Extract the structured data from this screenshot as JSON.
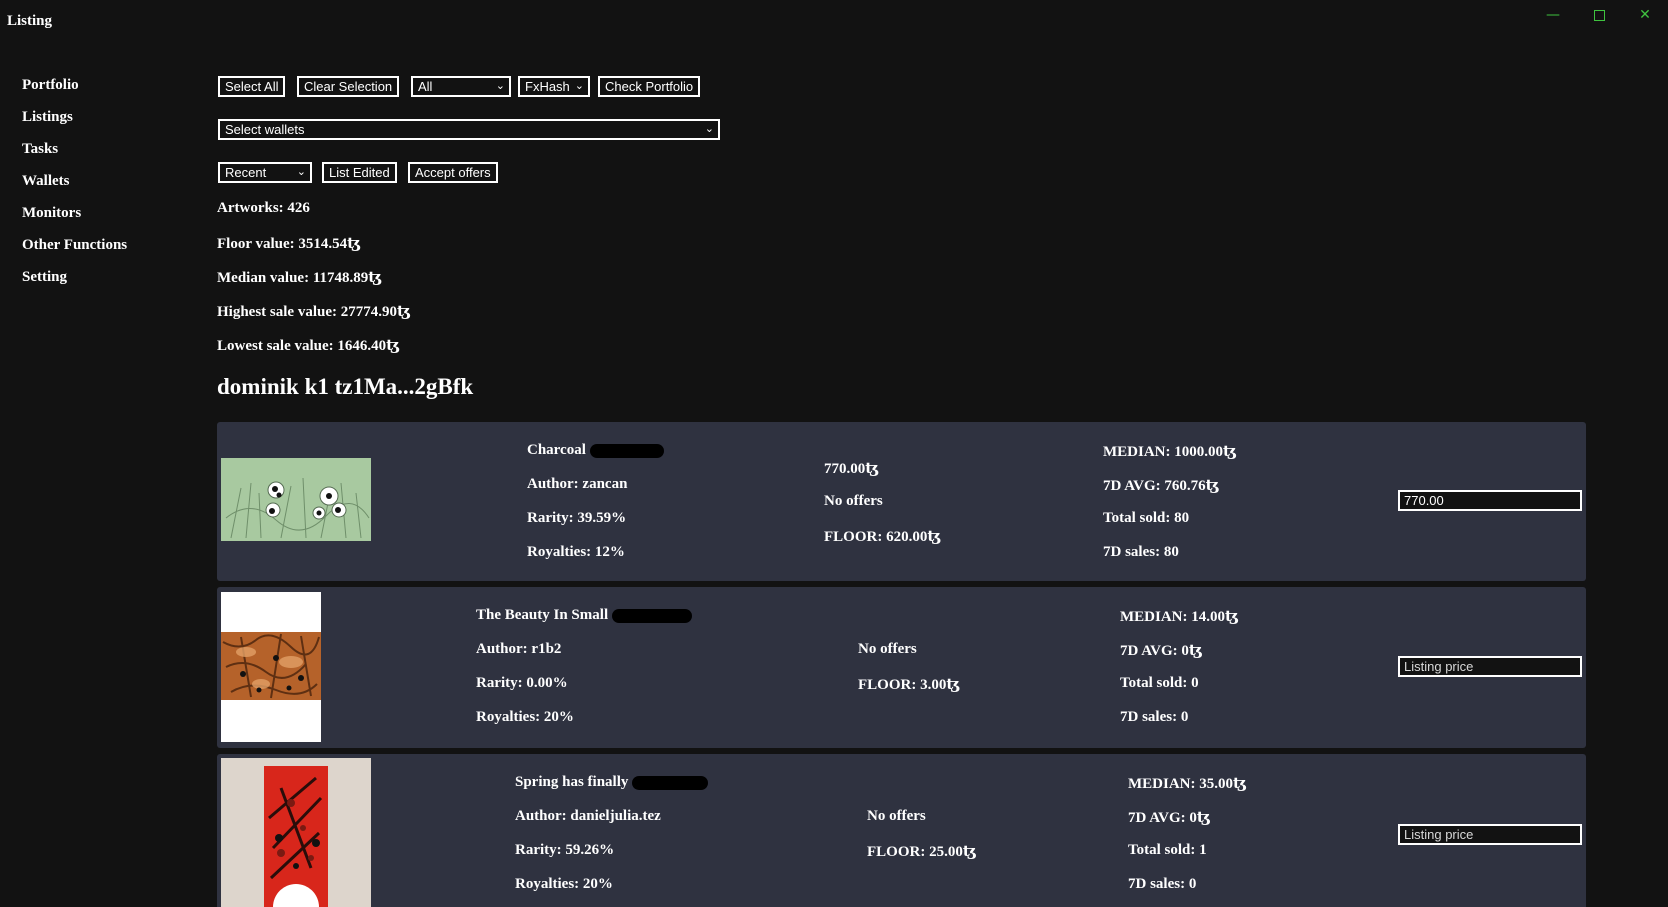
{
  "window": {
    "title": "Listing",
    "minimize_glyph": "—",
    "close_glyph": "✕"
  },
  "sidebar": {
    "items": [
      {
        "label": "Portfolio"
      },
      {
        "label": "Listings"
      },
      {
        "label": "Tasks"
      },
      {
        "label": "Wallets"
      },
      {
        "label": "Monitors"
      },
      {
        "label": "Other Functions"
      },
      {
        "label": "Setting"
      }
    ]
  },
  "toolbar": {
    "select_all": "Select All",
    "clear_selection": "Clear Selection",
    "filter_select": "All",
    "platform_select": "FxHash",
    "check_portfolio": "Check Portfolio",
    "wallet_select": "Select wallets",
    "sort_select": "Recent",
    "list_edited": "List Edited",
    "accept_offers": "Accept offers",
    "chevron_glyph": "⌄"
  },
  "stats": {
    "artworks": "Artworks: 426",
    "floor": "Floor value: 3514.54ꜩ",
    "median": "Median value: 11748.89ꜩ",
    "highest": "Highest sale value: 27774.90ꜩ",
    "lowest": "Lowest sale value: 1646.40ꜩ"
  },
  "wallet_heading": "dominik k1 tz1Ma...2gBfk",
  "listings": [
    {
      "title": "Charcoal",
      "author": "Author: zancan",
      "rarity": "Rarity: 39.59%",
      "royalties": "Royalties: 12%",
      "current_price": "770.00ꜩ",
      "offers": "No offers",
      "floor": "FLOOR: 620.00ꜩ",
      "median": "MEDIAN: 1000.00ꜩ",
      "avg7d": "7D AVG: 760.76ꜩ",
      "total_sold": "Total sold: 80",
      "sales7d": "7D sales: 80",
      "price_value": "770.00",
      "price_placeholder": "Listing price",
      "thumb_colors": {
        "bg": "#a8c9a0",
        "accent": "#6f8f6a"
      }
    },
    {
      "title": "The Beauty In Small",
      "author": "Author: r1b2",
      "rarity": "Rarity: 0.00%",
      "royalties": "Royalties: 20%",
      "current_price": "",
      "offers": "No offers",
      "floor": "FLOOR: 3.00ꜩ",
      "median": "MEDIAN: 14.00ꜩ",
      "avg7d": "7D AVG: 0ꜩ",
      "total_sold": "Total sold: 0",
      "sales7d": "7D sales: 0",
      "price_value": "",
      "price_placeholder": "Listing price",
      "thumb_colors": {
        "bg": "#ffffff",
        "accent": "#b5622a"
      }
    },
    {
      "title": "Spring has finally",
      "author": "Author: danieljulia.tez",
      "rarity": "Rarity: 59.26%",
      "royalties": "Royalties: 20%",
      "current_price": "",
      "offers": "No offers",
      "floor": "FLOOR: 25.00ꜩ",
      "median": "MEDIAN: 35.00ꜩ",
      "avg7d": "7D AVG: 0ꜩ",
      "total_sold": "Total sold: 1",
      "sales7d": "7D sales: 0",
      "price_value": "",
      "price_placeholder": "Listing price",
      "thumb_colors": {
        "bg": "#ddd5cc",
        "accent": "#d8261b"
      }
    }
  ],
  "colors": {
    "background": "#121212",
    "card": "#2f3240",
    "window_controls": "#3fc23f"
  }
}
